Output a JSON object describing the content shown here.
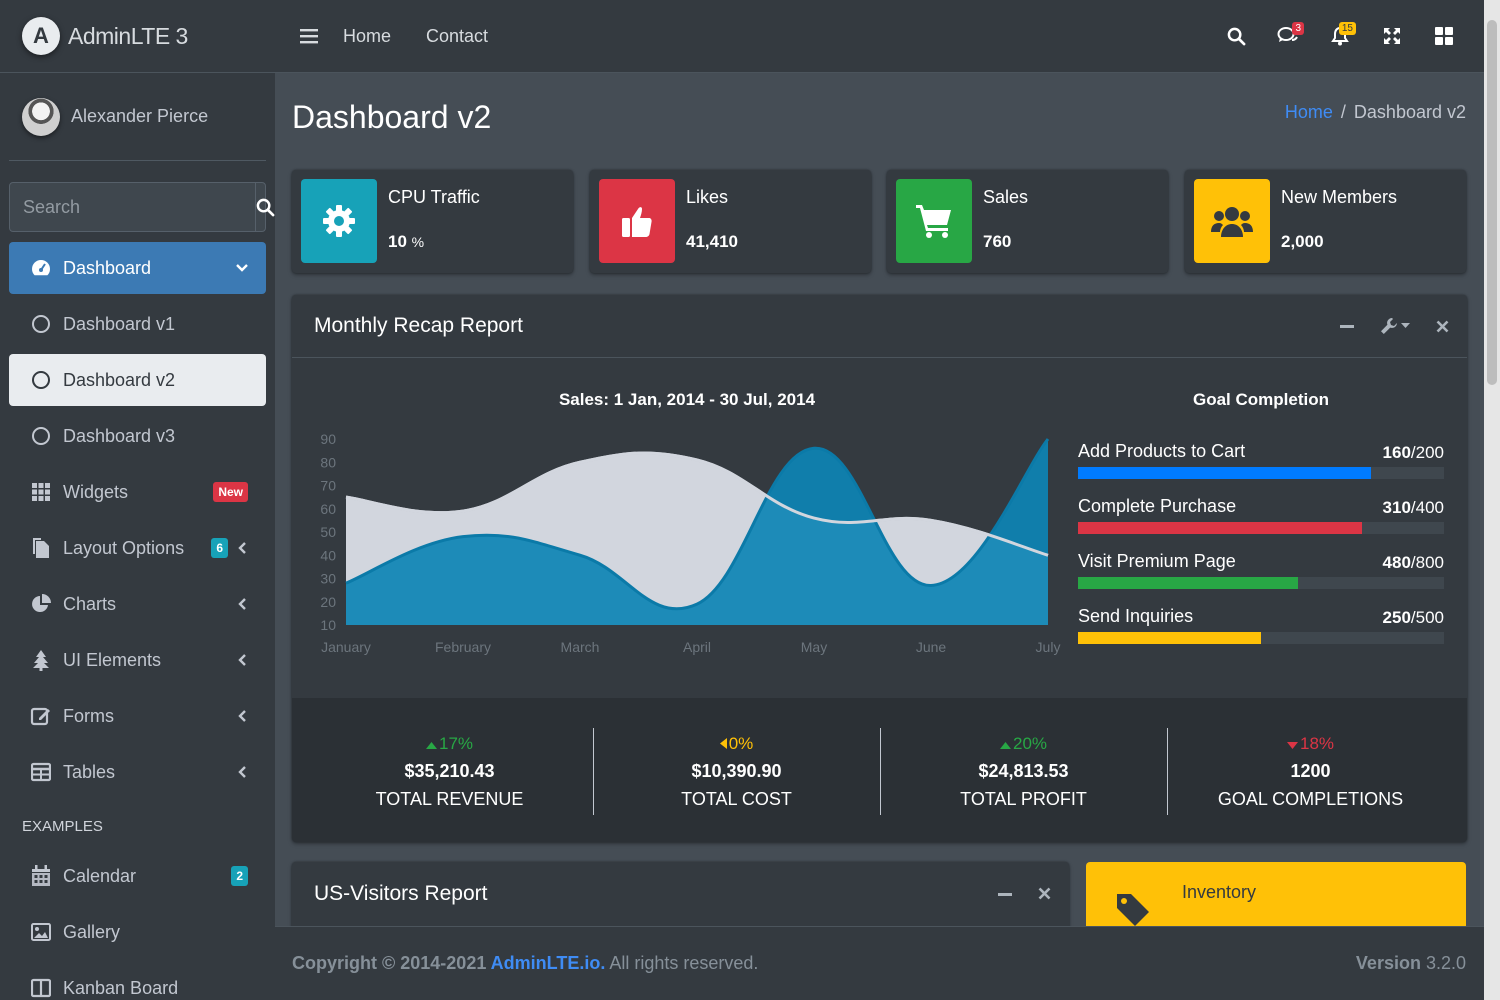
{
  "brand": {
    "logo_letter": "A",
    "name": "AdminLTE 3"
  },
  "user": {
    "name": "Alexander Pierce"
  },
  "sidebar_search": {
    "placeholder": "Search"
  },
  "nav": {
    "dashboard": "Dashboard",
    "dashboard_v1": "Dashboard v1",
    "dashboard_v2": "Dashboard v2",
    "dashboard_v3": "Dashboard v3",
    "widgets": "Widgets",
    "widgets_badge": "New",
    "layout_options": "Layout Options",
    "layout_badge": "6",
    "charts": "Charts",
    "ui_elements": "UI Elements",
    "forms": "Forms",
    "tables": "Tables",
    "examples_header": "EXAMPLES",
    "calendar": "Calendar",
    "calendar_badge": "2",
    "gallery": "Gallery",
    "kanban": "Kanban Board"
  },
  "topnav": {
    "home": "Home",
    "contact": "Contact",
    "messages_badge": "3",
    "notifications_badge": "15"
  },
  "page": {
    "title": "Dashboard v2",
    "breadcrumb_home": "Home",
    "breadcrumb_sep": "/",
    "breadcrumb_current": "Dashboard v2"
  },
  "info_boxes": [
    {
      "label": "CPU Traffic",
      "value": "10",
      "unit": "%",
      "color": "#17a2b8",
      "icon": "gear-icon"
    },
    {
      "label": "Likes",
      "value": "41,410",
      "color": "#dc3545",
      "icon": "thumbs-up-icon"
    },
    {
      "label": "Sales",
      "value": "760",
      "color": "#28a745",
      "icon": "shopping-cart-icon"
    },
    {
      "label": "New Members",
      "value": "2,000",
      "color": "#ffc107",
      "icon": "users-icon"
    }
  ],
  "recap": {
    "title": "Monthly Recap Report",
    "chart_title": "Sales: 1 Jan, 2014 - 30 Jul, 2014",
    "goal_title": "Goal Completion",
    "goals": [
      {
        "label": "Add Products to Cart",
        "done": "160",
        "total": "/200",
        "fraction": 0.8,
        "color": "#007bff"
      },
      {
        "label": "Complete Purchase",
        "done": "310",
        "total": "/400",
        "fraction": 0.775,
        "color": "#dc3545"
      },
      {
        "label": "Visit Premium Page",
        "done": "480",
        "total": "/800",
        "fraction": 0.6,
        "color": "#28a745"
      },
      {
        "label": "Send Inquiries",
        "done": "250",
        "total": "/500",
        "fraction": 0.5,
        "color": "#ffc107"
      }
    ],
    "stats": [
      {
        "pct": "17%",
        "trend": "up",
        "amount": "$35,210.43",
        "label": "TOTAL REVENUE",
        "color": "#28a745"
      },
      {
        "pct": "0%",
        "trend": "left",
        "amount": "$10,390.90",
        "label": "TOTAL COST",
        "color": "#ffc107"
      },
      {
        "pct": "20%",
        "trend": "up",
        "amount": "$24,813.53",
        "label": "TOTAL PROFIT",
        "color": "#28a745"
      },
      {
        "pct": "18%",
        "trend": "down",
        "amount": "1200",
        "label": "GOAL COMPLETIONS",
        "color": "#dc3545"
      }
    ]
  },
  "chart_data": {
    "type": "area",
    "title": "Sales: 1 Jan, 2014 - 30 Jul, 2014",
    "categories": [
      "January",
      "February",
      "March",
      "April",
      "May",
      "June",
      "July"
    ],
    "ylim": [
      10,
      90
    ],
    "yticks": [
      "10",
      "20",
      "30",
      "40",
      "50",
      "60",
      "70",
      "80",
      "90"
    ],
    "grid": false,
    "series": [
      {
        "values": [
          28,
          48,
          40,
          19,
          86,
          27,
          90
        ],
        "color": "#0d84b4"
      },
      {
        "values": [
          65,
          59,
          80,
          81,
          56,
          55,
          40
        ],
        "color": "#d2d6de"
      }
    ]
  },
  "us_visitors": {
    "title": "US-Visitors Report"
  },
  "inventory": {
    "label": "Inventory",
    "color": "#ffc107"
  },
  "footer": {
    "copyright": "Copyright © 2014-2021 ",
    "link": "AdminLTE.io.",
    "rights": " All rights reserved.",
    "version_label": "Version",
    "version": " 3.2.0"
  }
}
